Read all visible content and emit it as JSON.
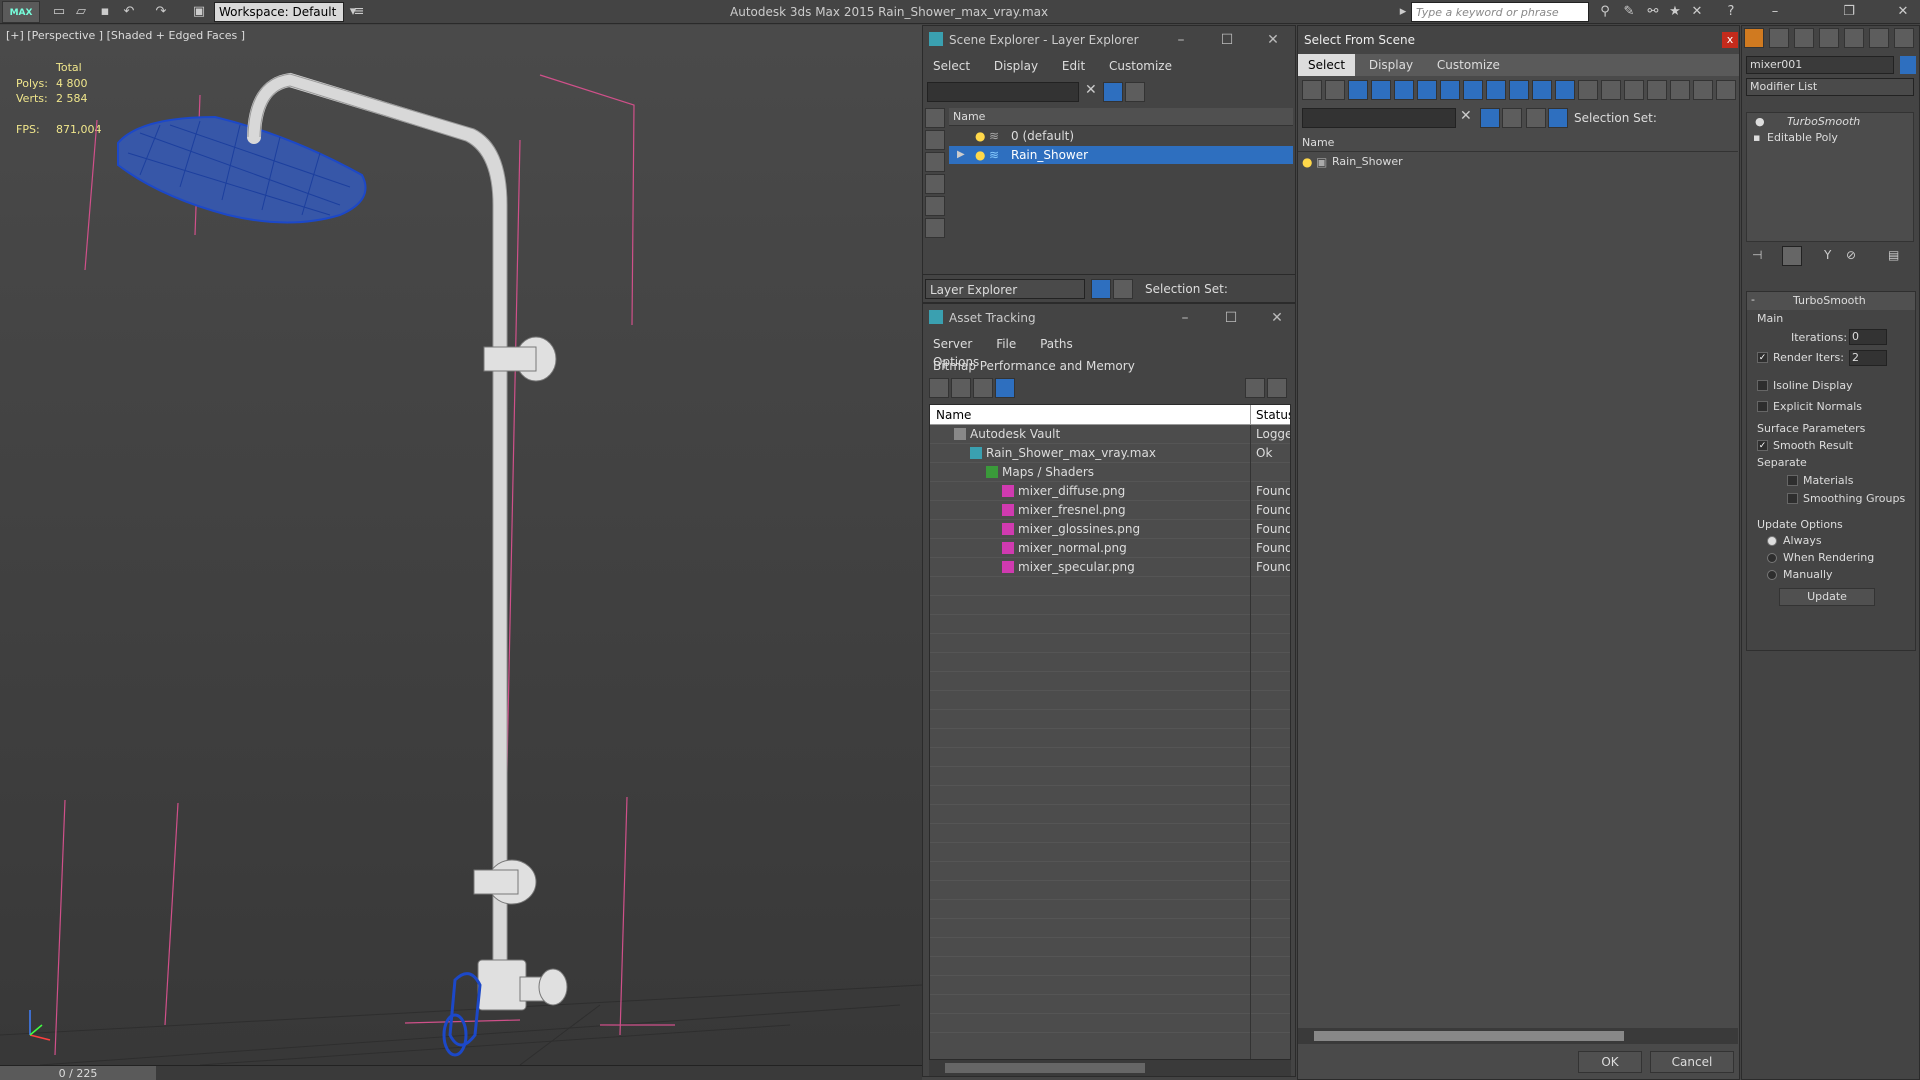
{
  "titlebar": {
    "logo": "MAX",
    "workspace": "Workspace: Default",
    "app_title": "Autodesk 3ds Max  2015     Rain_Shower_max_vray.max",
    "search_placeholder": "Type a keyword or phrase"
  },
  "viewport": {
    "label": "[+] [Perspective ] [Shaded + Edged Faces ]",
    "total_label": "Total",
    "polys_label": "Polys:",
    "polys_value": "4 800",
    "verts_label": "Verts:",
    "verts_value": "2 584",
    "fps_label": "FPS:",
    "fps_value": "871,004",
    "timeline": "0 / 225"
  },
  "scene_explorer": {
    "title": "Scene Explorer - Layer Explorer",
    "menu": [
      "Select",
      "Display",
      "Edit",
      "Customize"
    ],
    "column_name": "Name",
    "rows": [
      "0 (default)",
      "Rain_Shower"
    ],
    "footer_mode": "Layer Explorer",
    "footer_selection_set": "Selection Set:"
  },
  "asset_tracking": {
    "title": "Asset Tracking",
    "menu": [
      "Server",
      "File",
      "Paths",
      "Bitmap Performance and Memory"
    ],
    "menu2": "Options",
    "col_name": "Name",
    "col_status": "Status",
    "rows": [
      {
        "name": "Autodesk Vault",
        "status": "Logged",
        "indent": 0
      },
      {
        "name": "Rain_Shower_max_vray.max",
        "status": "Ok",
        "indent": 1
      },
      {
        "name": "Maps / Shaders",
        "status": "",
        "indent": 2
      },
      {
        "name": "mixer_diffuse.png",
        "status": "Found",
        "indent": 3
      },
      {
        "name": "mixer_fresnel.png",
        "status": "Found",
        "indent": 3
      },
      {
        "name": "mixer_glossines.png",
        "status": "Found",
        "indent": 3
      },
      {
        "name": "mixer_normal.png",
        "status": "Found",
        "indent": 3
      },
      {
        "name": "mixer_specular.png",
        "status": "Found",
        "indent": 3
      }
    ]
  },
  "select_from_scene": {
    "title": "Select From Scene",
    "menu": [
      "Select",
      "Display",
      "Customize"
    ],
    "selection_set": "Selection Set:",
    "column_name": "Name",
    "rows": [
      "Rain_Shower"
    ],
    "ok_label": "OK",
    "cancel_label": "Cancel"
  },
  "command_panel": {
    "object_name": "mixer001",
    "modifier_list": "Modifier List",
    "stack": [
      "TurboSmooth",
      "Editable Poly"
    ],
    "rollout_title": "TurboSmooth",
    "main_label": "Main",
    "iterations_label": "Iterations:",
    "iterations_value": "0",
    "render_iters_label": "Render Iters:",
    "render_iters_value": "2",
    "isoline_label": "Isoline Display",
    "explicit_normals_label": "Explicit Normals",
    "surface_params_label": "Surface Parameters",
    "smooth_result_label": "Smooth Result",
    "separate_label": "Separate",
    "materials_label": "Materials",
    "smoothing_groups_label": "Smoothing Groups",
    "update_options_label": "Update Options",
    "always_label": "Always",
    "when_rendering_label": "When Rendering",
    "manually_label": "Manually",
    "update_button": "Update"
  },
  "colors": {
    "selection_blue": "#2e6fbf",
    "stat_yellow": "#f0e68c",
    "close_red": "#c42b1c"
  }
}
